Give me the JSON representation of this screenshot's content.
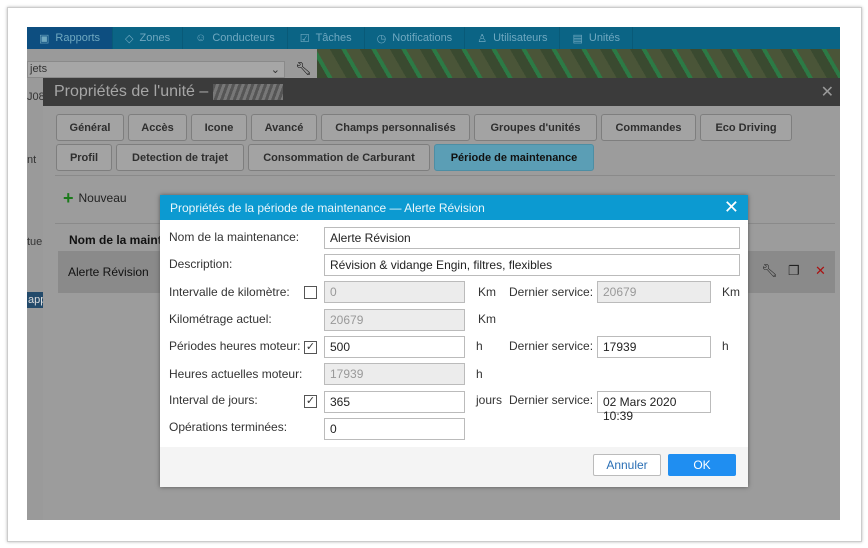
{
  "nav": {
    "items": [
      {
        "icon": "chart-icon",
        "label": "Rapports"
      },
      {
        "icon": "zones-icon",
        "label": "Zones"
      },
      {
        "icon": "driver-icon",
        "label": "Conducteurs"
      },
      {
        "icon": "task-icon",
        "label": "Tâches"
      },
      {
        "icon": "clock-icon",
        "label": "Notifications"
      },
      {
        "icon": "users-icon",
        "label": "Utilisateurs"
      },
      {
        "icon": "vehicle-icon",
        "label": "Unités"
      }
    ]
  },
  "left": {
    "select_value": "jets",
    "frag1": "J08",
    "frag2": "nt",
    "frag3": "tuel",
    "frag4": "app"
  },
  "unit_dialog": {
    "title": "Propriétés de l'unité –",
    "tabs_row1": [
      "Général",
      "Accès",
      "Icone",
      "Avancé",
      "Champs personnalisés",
      "Groupes d'unités",
      "Commandes",
      "Eco Driving"
    ],
    "tabs_row2": [
      "Profil",
      "Detection de trajet",
      "Consommation de Carburant",
      "Période de maintenance"
    ],
    "active_tab": "Période de maintenance",
    "new_label": "Nouveau",
    "column_header": "Nom de la maintenance",
    "rows": [
      {
        "name": "Alerte Révision"
      }
    ]
  },
  "maint_dialog": {
    "title": "Propriétés de la période de maintenance — Alerte Révision",
    "name_label": "Nom de la maintenance:",
    "name_value": "Alerte Révision",
    "desc_label": "Description:",
    "desc_value": "Révision & vidange Engin, filtres, flexibles",
    "km_interval_label": "Intervalle de kilomètre:",
    "km_interval_checked": false,
    "km_interval_value": "0",
    "km_unit": "Km",
    "last_service_label": "Dernier service:",
    "km_last_service": "20679",
    "km_current_label": "Kilométrage actuel:",
    "km_current_value": "20679",
    "hours_label": "Périodes heures moteur:",
    "hours_checked": true,
    "hours_value": "500",
    "h_unit": "h",
    "hours_last_service": "17939",
    "hours_current_label": "Heures actuelles moteur:",
    "hours_current_value": "17939",
    "days_label": "Interval de jours:",
    "days_checked": true,
    "days_value": "365",
    "days_unit": "jours",
    "days_last_service": "02 Mars 2020 10:39",
    "ops_label": "Opérations terminées:",
    "ops_value": "0",
    "cancel_label": "Annuler",
    "ok_label": "OK"
  }
}
